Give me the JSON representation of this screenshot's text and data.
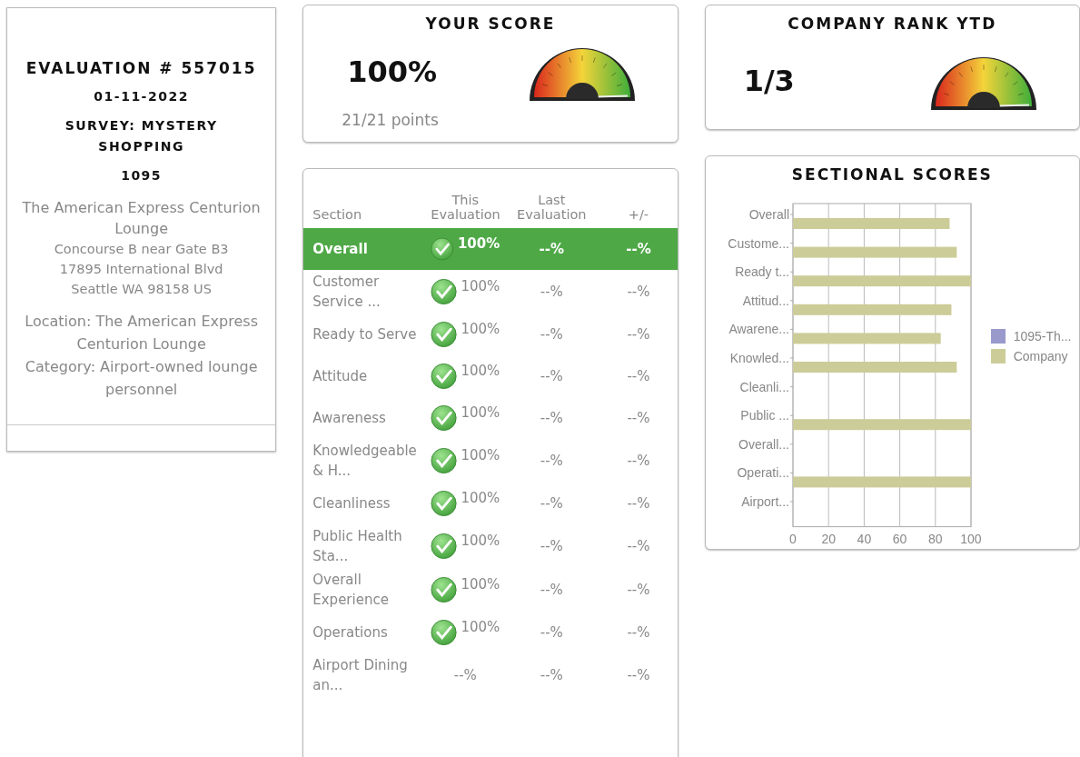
{
  "evaluation": {
    "title": "EVALUATION # 557015",
    "date": "01-11-2022",
    "survey": "SURVEY: MYSTERY SHOPPING",
    "code": "1095",
    "location_name": "The American Express Centurion Lounge",
    "address_lines": [
      "Concourse B near Gate B3",
      "17895 International Blvd",
      "Seattle WA 98158 US"
    ],
    "details": [
      "Location: The American Express Centurion Lounge",
      "Category: Airport-owned lounge personnel"
    ]
  },
  "score": {
    "title": "YOUR SCORE",
    "value": "100%",
    "points": "21/21 points"
  },
  "rank": {
    "title": "COMPANY RANK YTD",
    "value": "1/3"
  },
  "table": {
    "columns": [
      "Section",
      "This Evaluation",
      "Last Evaluation",
      "+/-"
    ],
    "rows": [
      {
        "section": "Overall",
        "this": "100%",
        "last": "--%",
        "change": "--%",
        "passed": true,
        "highlighted": true
      },
      {
        "section": "Customer Service ...",
        "this": "100%",
        "last": "--%",
        "change": "--%",
        "passed": true,
        "highlighted": false
      },
      {
        "section": "Ready to Serve",
        "this": "100%",
        "last": "--%",
        "change": "--%",
        "passed": true,
        "highlighted": false
      },
      {
        "section": "Attitude",
        "this": "100%",
        "last": "--%",
        "change": "--%",
        "passed": true,
        "highlighted": false
      },
      {
        "section": "Awareness",
        "this": "100%",
        "last": "--%",
        "change": "--%",
        "passed": true,
        "highlighted": false
      },
      {
        "section": "Knowledgeable & H...",
        "this": "100%",
        "last": "--%",
        "change": "--%",
        "passed": true,
        "highlighted": false
      },
      {
        "section": "Cleanliness",
        "this": "100%",
        "last": "--%",
        "change": "--%",
        "passed": true,
        "highlighted": false
      },
      {
        "section": "Public Health Sta...",
        "this": "100%",
        "last": "--%",
        "change": "--%",
        "passed": true,
        "highlighted": false
      },
      {
        "section": "Overall Experience",
        "this": "100%",
        "last": "--%",
        "change": "--%",
        "passed": true,
        "highlighted": false
      },
      {
        "section": "Operations",
        "this": "100%",
        "last": "--%",
        "change": "--%",
        "passed": true,
        "highlighted": false
      },
      {
        "section": "Airport Dining an...",
        "this": "--%",
        "last": "--%",
        "change": "--%",
        "passed": false,
        "highlighted": false
      }
    ]
  },
  "sectional": {
    "title": "SECTIONAL SCORES",
    "chart_data": {
      "type": "bar",
      "orientation": "horizontal",
      "categories": [
        "Overall",
        "Custome...",
        "Ready t...",
        "Attitud...",
        "Awarene...",
        "Knowled...",
        "Cleanli...",
        "Public ...",
        "Overall...",
        "Operati...",
        "Airport..."
      ],
      "series": [
        {
          "name": "1095-Th...",
          "color": "#9999cc",
          "values": [
            null,
            null,
            null,
            null,
            null,
            null,
            null,
            null,
            null,
            null,
            null
          ]
        },
        {
          "name": "Company",
          "color": "#cccc99",
          "values": [
            88,
            92,
            100,
            89,
            83,
            92,
            null,
            100,
            null,
            100,
            null
          ]
        }
      ],
      "xlim": [
        0,
        100
      ],
      "xticks": [
        0,
        20,
        40,
        60,
        80,
        100
      ],
      "grid": true
    }
  }
}
